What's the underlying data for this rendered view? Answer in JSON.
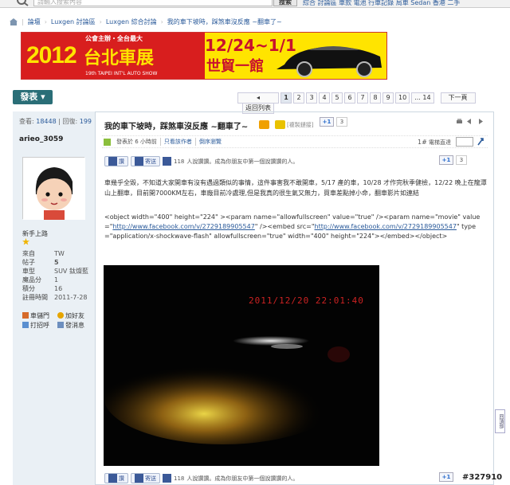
{
  "search": {
    "placeholder": "請輸入搜索內容",
    "button": "搜索",
    "categories": "綜合 討論區 車款 電池 行車記錄 局車 Sedan 香港 二手"
  },
  "breadcrumb": [
    "論壇",
    "Luxgen 討論區",
    "Luxgen 綜合討論",
    "我的車下坡時，踩煞車沒反應 ~翻車了~"
  ],
  "banner": {
    "year": "2012",
    "topline": "公會主辦・全台最大",
    "city": "台北車展",
    "subtitle": "19th TAIPEI INT'L AUTO SHOW",
    "dates": "12/24~1/1",
    "venue": "世貿一館"
  },
  "toolbar": {
    "post_button": "發表"
  },
  "pagination": {
    "back": "返回列表",
    "pages": [
      "1",
      "2",
      "3",
      "4",
      "5",
      "6",
      "7",
      "8",
      "9",
      "10",
      "... 14"
    ],
    "current": "1",
    "next": "下一頁"
  },
  "user": {
    "views_label": "查看:",
    "views": "18448",
    "replies_label": "回復:",
    "replies": "199",
    "name": "arieo_3059",
    "rank": "新手上路",
    "fields": [
      {
        "k": "來自",
        "v": "TW"
      },
      {
        "k": "帖子",
        "v": "5"
      },
      {
        "k": "車型",
        "v": "SUV 鈦燦藍"
      },
      {
        "k": "魔品分",
        "v": "1"
      },
      {
        "k": "積分",
        "v": "16"
      },
      {
        "k": "註冊時間",
        "v": "2011-7-28"
      }
    ],
    "actions": [
      "車儲門",
      "加好友",
      "打招呼",
      "發消息"
    ]
  },
  "thread": {
    "title": "我的車下坡時，踩煞車沒反應 ~翻車了~",
    "copy_link": "[複製鏈接]",
    "plus_one": "+1",
    "gp_count_top": "3",
    "gp_count_mid": "3",
    "posted": "發表於 6 小時前",
    "only_author": "只看該作者",
    "reverse": "倒序瀏覽",
    "floor": "1#",
    "goto_label": "電梯直達",
    "like": "讚",
    "send": "寄送",
    "like_count": "118",
    "like_text": "人說讚讚。成為你朋友中第一個說讚讚的人。",
    "body": "車幾乎全毀，不知道大家開車有沒有遇過類似的事情，這件事害我不敢開車，5/17 產的車，10/28 才作完秋季健檢，12/22 晚上在龍潭山上翻車，目前開7000KM左右，車廠目前冷處理,但是我真的很生氣又無力，買車差點掉小命，翻車影片如連結",
    "code_pre1": "<object width=\"400\" height=\"224\" ><param name=\"allowfullscreen\" value=\"true\" /><param name=\"movie\" value=\"",
    "link1": "http://www.facebook.com/v/2729189905547",
    "code_mid": "\" /><embed src=\"",
    "link2": "http://www.facebook.com/v/2729189905547",
    "code_post": "\" type=\"application/x-shockwave-flash\" allowfullscreen=\"true\" width=\"400\" height=\"224\"></embed></object>",
    "video_timestamp": "2011/12/20 22:01:40",
    "back_to_top": "回頂部"
  },
  "watermark": "#327910"
}
